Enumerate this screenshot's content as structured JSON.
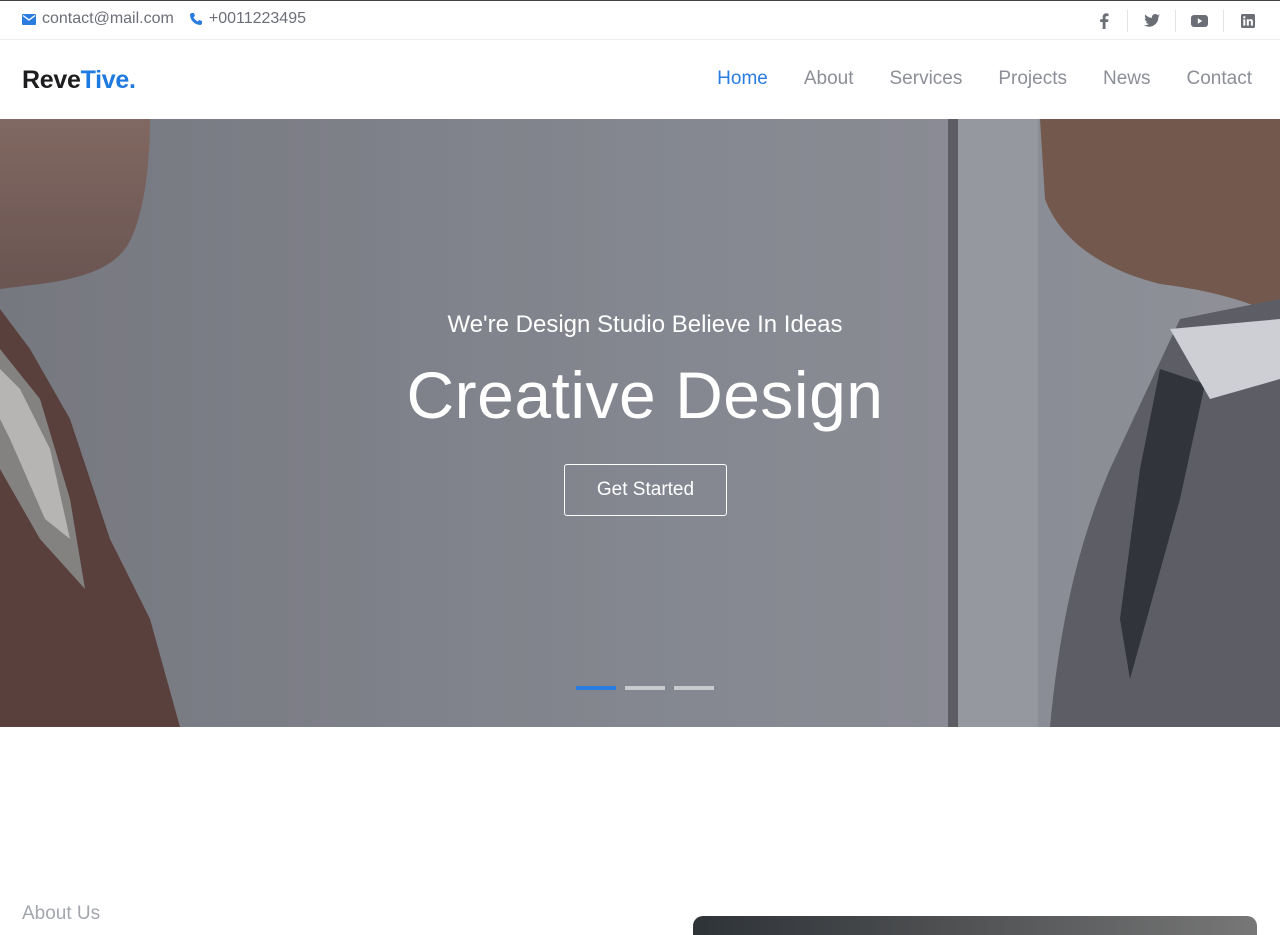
{
  "topbar": {
    "email": "contact@mail.com",
    "phone": "+0011223495",
    "social": [
      "facebook-icon",
      "twitter-icon",
      "youtube-icon",
      "linkedin-icon"
    ]
  },
  "header": {
    "logo_part1": "Reve",
    "logo_part2": "Tive.",
    "nav": [
      {
        "label": "Home",
        "active": true
      },
      {
        "label": "About"
      },
      {
        "label": "Services"
      },
      {
        "label": "Projects"
      },
      {
        "label": "News"
      },
      {
        "label": "Contact"
      }
    ]
  },
  "hero": {
    "subtitle": "We're Design Studio Believe In Ideas",
    "title": "Creative Design",
    "cta": "Get Started",
    "slides": 3,
    "active_slide": 1
  },
  "about": {
    "label": "About Us"
  },
  "colors": {
    "accent": "#2a7ce0",
    "nav_text": "#8c8f97"
  }
}
